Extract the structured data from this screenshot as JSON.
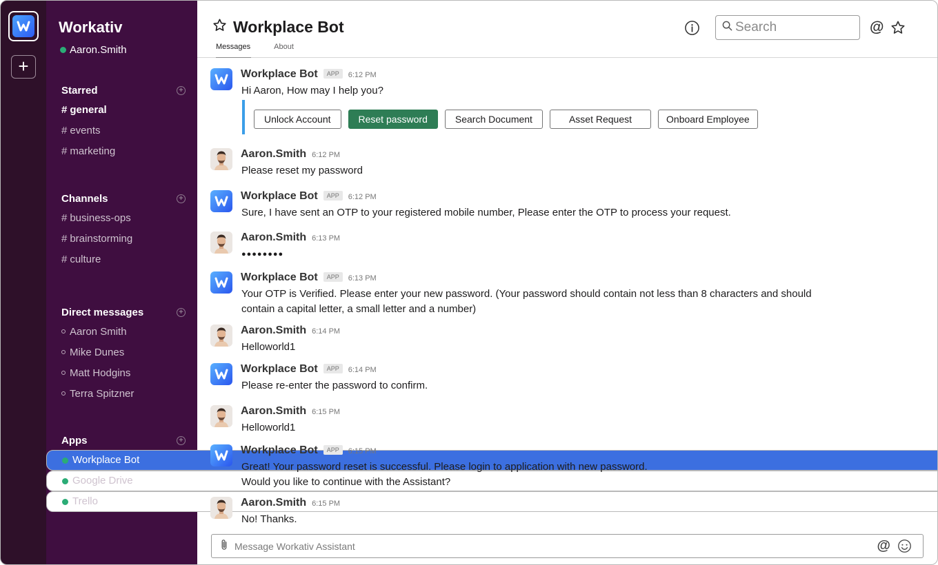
{
  "workspace": {
    "name": "Workativ",
    "user": "Aaron.Smith"
  },
  "sidebar": {
    "starred": {
      "title": "Starred",
      "items": [
        "general",
        "events",
        "marketing"
      ]
    },
    "channels": {
      "title": "Channels",
      "items": [
        "business-ops",
        "brainstorming",
        "culture"
      ]
    },
    "direct_messages": {
      "title": "Direct messages",
      "items": [
        "Aaron Smith",
        "Mike Dunes",
        "Matt Hodgins",
        "Terra Spitzner"
      ]
    },
    "apps": {
      "title": "Apps",
      "items": [
        "Workplace Bot",
        "Google Drive",
        "Trello"
      ],
      "active": "Workplace Bot"
    }
  },
  "header": {
    "title": "Workplace Bot",
    "tabs": [
      "Messages",
      "About"
    ],
    "active_tab": "Messages",
    "search_placeholder": "Search"
  },
  "tag_label": "APP",
  "messages": [
    {
      "sender": "Workplace Bot",
      "bot": true,
      "time": "6:12 PM",
      "text": "Hi Aaron, How may I help you?"
    },
    {
      "sender": "Aaron.Smith",
      "bot": false,
      "time": "6:12 PM",
      "text": "Please reset my password"
    },
    {
      "sender": "Workplace Bot",
      "bot": true,
      "time": "6:12 PM",
      "text": "Sure, I have sent an OTP to your registered mobile number, Please enter the OTP to process your request."
    },
    {
      "sender": "Aaron.Smith",
      "bot": false,
      "time": "6:13 PM",
      "text": "●●●●●●●●"
    },
    {
      "sender": "Workplace Bot",
      "bot": true,
      "time": "6:13 PM",
      "text": "Your OTP is Verified. Please enter your new password. (Your password should contain not less than 8 characters and should",
      "text2": "contain a capital letter, a small letter and a number)"
    },
    {
      "sender": "Aaron.Smith",
      "bot": false,
      "time": "6:14 PM",
      "text": "Helloworld1"
    },
    {
      "sender": "Workplace Bot",
      "bot": true,
      "time": "6:14 PM",
      "text": "Please re-enter the password to confirm."
    },
    {
      "sender": "Aaron.Smith",
      "bot": false,
      "time": "6:15 PM",
      "text": "Helloworld1"
    },
    {
      "sender": "Workplace Bot",
      "bot": true,
      "time": "6:15 PM",
      "text": "Great! Your password reset is successful. Please login to application with new password.",
      "text2": "Would you like to continue with the Assistant?"
    },
    {
      "sender": "Aaron.Smith",
      "bot": false,
      "time": "6:15 PM",
      "text": "No! Thanks."
    }
  ],
  "quick_replies": {
    "options": [
      "Unlock Account",
      "Reset password",
      "Search Document",
      "Asset Request",
      "Onboard Employee"
    ],
    "selected": "Reset password"
  },
  "composer": {
    "placeholder": "Message Workativ Assistant"
  },
  "colors": {
    "rail": "#2e1029",
    "sidebar": "#3f0e40",
    "active_item": "#3c6fe0",
    "online": "#2bac76",
    "primary_button": "#2e7d55",
    "quick_reply_border": "#3b9ee8"
  }
}
